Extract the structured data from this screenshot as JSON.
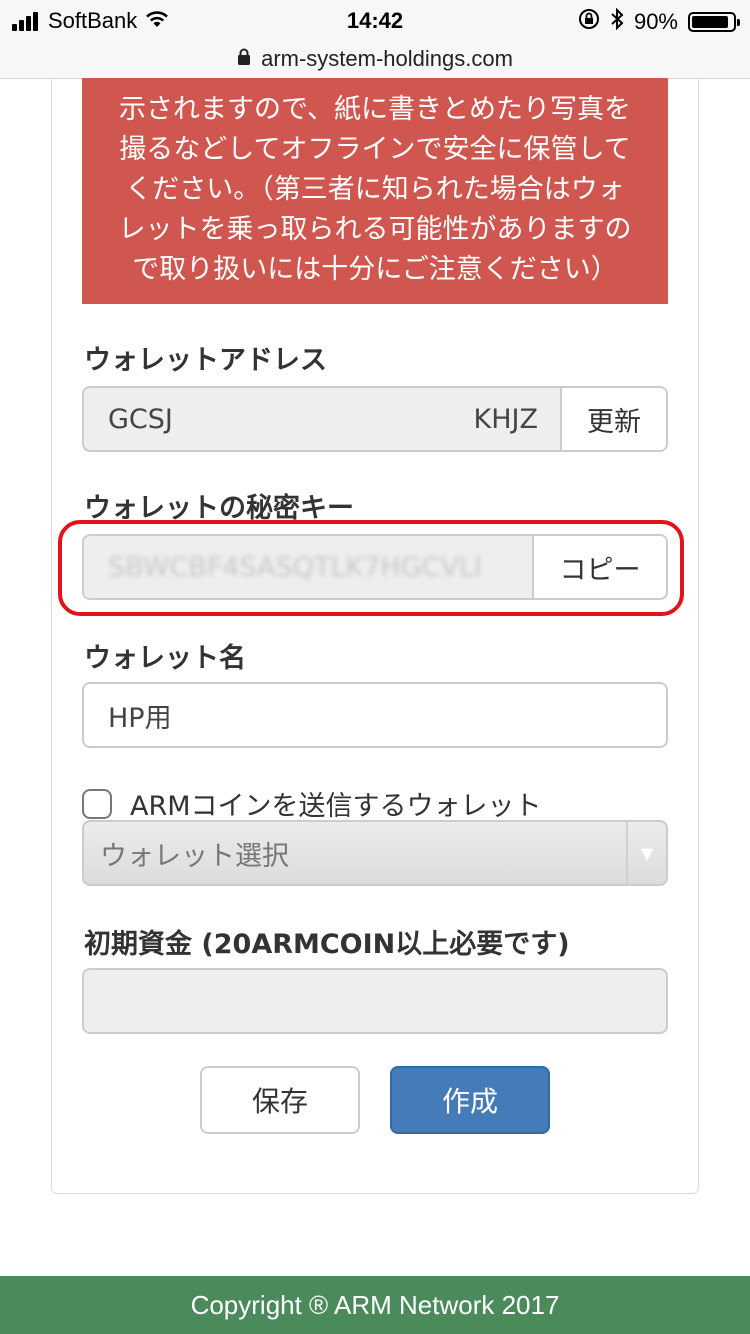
{
  "status_bar": {
    "carrier": "SoftBank",
    "time": "14:42",
    "battery": "90%",
    "battery_level": 0.9
  },
  "url_bar": {
    "url": "arm-system-holdings.com"
  },
  "warning": {
    "lines": [
      "示されますので、紙に書きとめたり写真を",
      "撮るなどしてオフラインで安全に保管して",
      "ください。（第三者に知られた場合はウォ",
      "レットを乗っ取られる可能性がありますの",
      "で取り扱いには十分にご注意ください）"
    ],
    "color": "#d0574f"
  },
  "address": {
    "label": "ウォレットアドレス",
    "value_start": "GCSJ",
    "value_end": "KHJZ",
    "button": "更新"
  },
  "secret_key": {
    "label": "ウォレットの秘密キー",
    "value": "SBWCBF4SASQTLK7HGCVLI",
    "button": "コピー"
  },
  "wallet_name": {
    "label": "ウォレット名",
    "value": "HP用"
  },
  "send_wallet": {
    "checkbox_label": "ARMコインを送信するウォレット",
    "select_value": "ウォレット選択"
  },
  "initial_funds": {
    "label": "初期資金 (20ARMCOIN以上必要です)",
    "value": ""
  },
  "actions": {
    "save": "保存",
    "create": "作成",
    "create_color": "#457bb9"
  },
  "footer": {
    "text": "Copyright ® ARM Network 2017",
    "color": "#4a8a5b"
  }
}
